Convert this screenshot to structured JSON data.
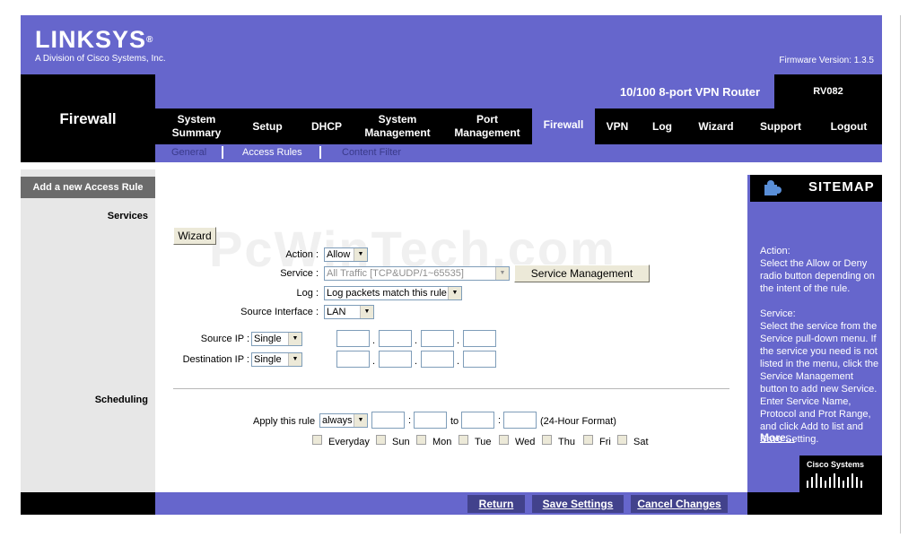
{
  "brand": {
    "name": "LINKSYS",
    "registered": "®",
    "tagline": "A Division of Cisco Systems, Inc."
  },
  "firmware": "Firmware Version: 1.3.5",
  "section_title": "Firewall",
  "product": {
    "name": "10/100 8-port VPN Router",
    "model": "RV082"
  },
  "tabs": [
    {
      "label": "System Summary"
    },
    {
      "label": "Setup"
    },
    {
      "label": "DHCP"
    },
    {
      "label": "System Management"
    },
    {
      "label": "Port Management"
    },
    {
      "label": "Firewall"
    },
    {
      "label": "VPN"
    },
    {
      "label": "Log"
    },
    {
      "label": "Wizard"
    },
    {
      "label": "Support"
    },
    {
      "label": "Logout"
    }
  ],
  "active_tab": "Firewall",
  "subtabs": [
    {
      "label": "General"
    },
    {
      "label": "Access Rules"
    },
    {
      "label": "Content Filter"
    }
  ],
  "left": {
    "header": "Add a new Access Rule",
    "services": "Services",
    "scheduling": "Scheduling"
  },
  "watermark": "PcWinTech.com",
  "form": {
    "wizard_label": "Wizard",
    "action_label": "Action :",
    "action_value": "Allow",
    "service_label": "Service :",
    "service_value": "All Traffic [TCP&UDP/1~65535]",
    "service_mgmt_label": "Service Management",
    "log_label": "Log :",
    "log_value": "Log packets match this rule",
    "source_interface_label": "Source Interface :",
    "source_interface_value": "LAN",
    "source_ip_label": "Source IP :",
    "source_ip_mode": "Single",
    "dest_ip_label": "Destination IP :",
    "dest_ip_mode": "Single",
    "ip_dot": ".",
    "apply_label": "Apply this rule",
    "apply_value": "always",
    "time_sep": ":",
    "to_label": "to",
    "format_label": "(24-Hour Format)",
    "days": [
      "Everyday",
      "Sun",
      "Mon",
      "Tue",
      "Wed",
      "Thu",
      "Fri",
      "Sat"
    ]
  },
  "sitemap": {
    "title": "SITEMAP",
    "paragraphs": [
      "Action:",
      "Select the Allow or Deny radio button depending on the intent of the rule.",
      "Service:",
      "Select the service from the Service pull-down menu. If the service you need is not listed in the menu, click the Service Management button to add new Service. Enter Service Name, Protocol and Prot Range, and click Add to list and Save Setting."
    ],
    "more": "More...",
    "cisco": "Cisco Systems"
  },
  "buttons": {
    "return": "Return",
    "save": "Save Settings",
    "cancel": "Cancel Changes"
  },
  "colors": {
    "accent": "#6666cc",
    "dark": "#000000",
    "button": "#42428c",
    "panel": "#e7e7e7",
    "header_gray": "#6b6b6b"
  }
}
